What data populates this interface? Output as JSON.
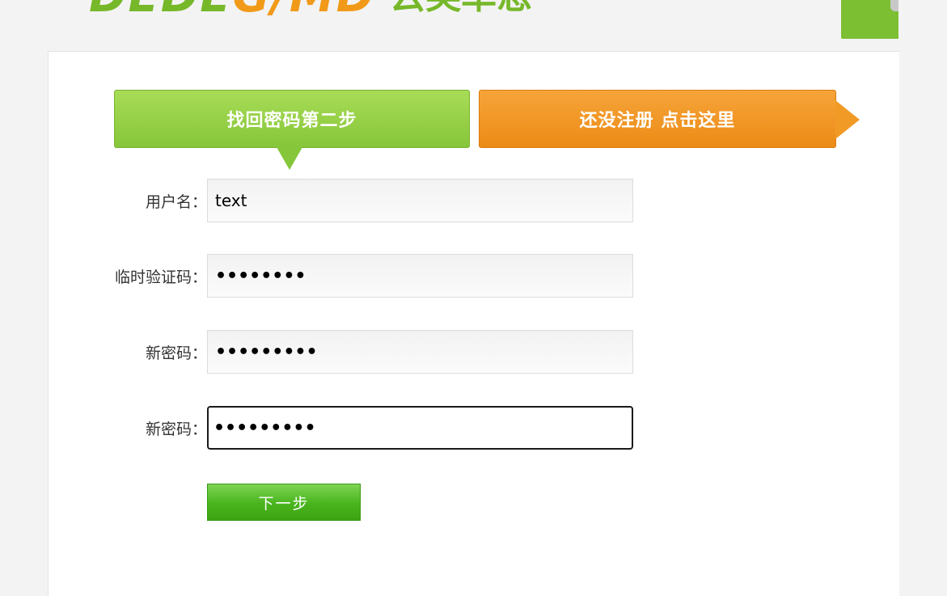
{
  "header": {
    "logo_latin_a": "DEDE",
    "logo_latin_b": "G/MD",
    "logo_cn": "云英单恩"
  },
  "tabs": {
    "step_label": "找回密码第二步",
    "register_label": "还没注册 点击这里"
  },
  "form": {
    "username": {
      "label": "用户名：",
      "value": "text"
    },
    "temp_code": {
      "label": "临时验证码：",
      "value": "••••••••"
    },
    "new_password": {
      "label": "新密码：",
      "value": "•••••••••"
    },
    "confirm_password": {
      "label": "新密码：",
      "value": "•••••••••"
    },
    "submit_label": "下一步"
  },
  "colors": {
    "green_accent": "#86c63a",
    "orange_accent": "#f19a26",
    "button_green": "#48b41c"
  }
}
